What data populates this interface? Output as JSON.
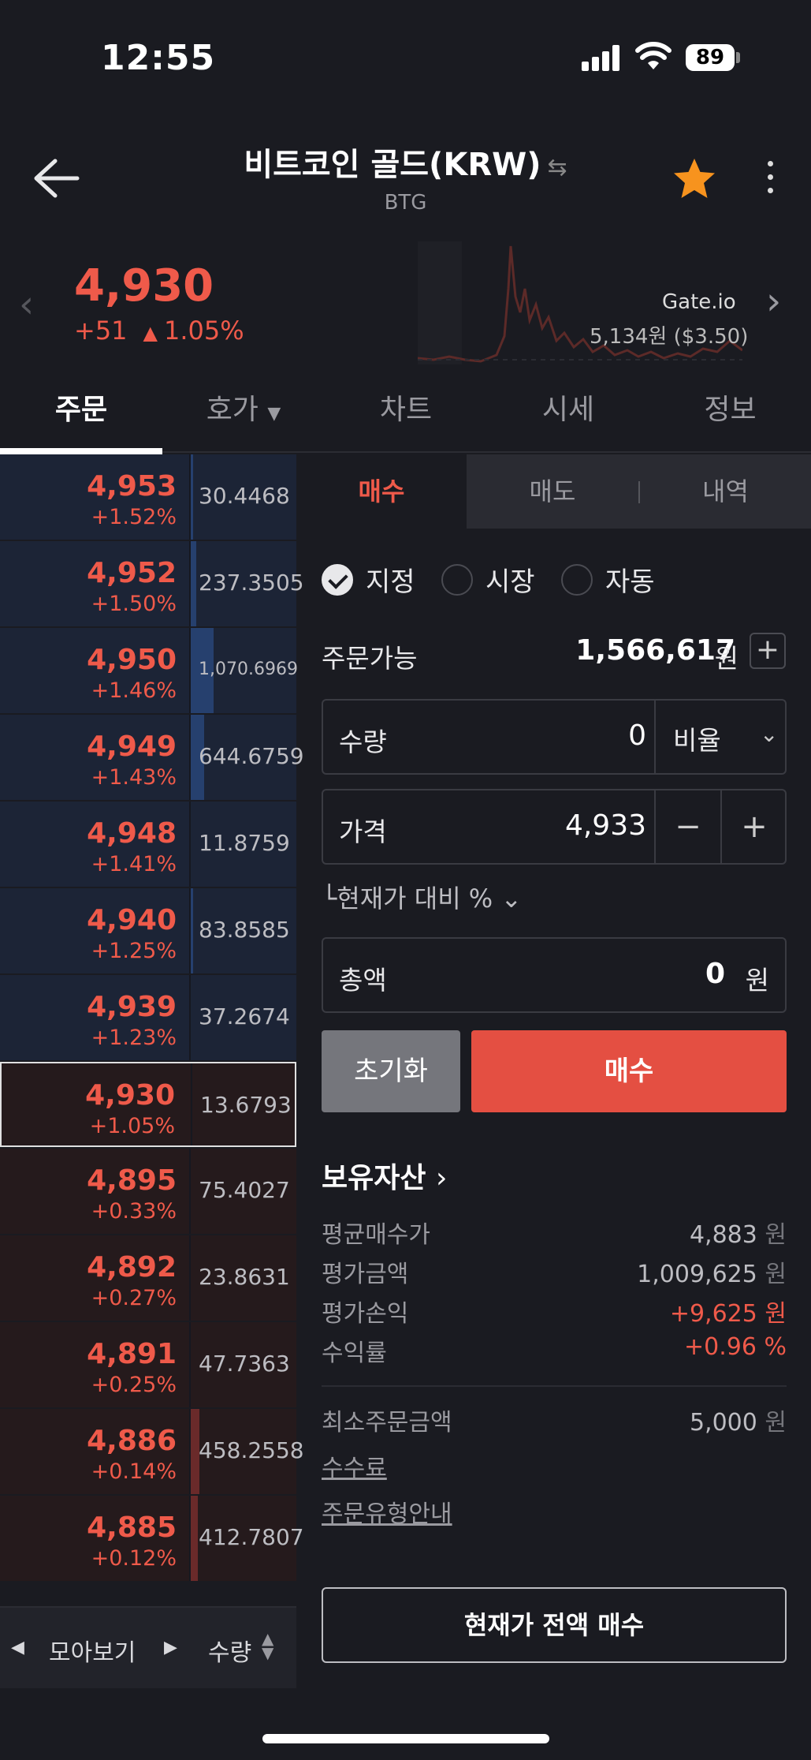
{
  "status": {
    "time": "12:55",
    "battery": "89"
  },
  "header": {
    "title": "비트코인 골드(KRW)",
    "subtitle": "BTG"
  },
  "price": {
    "current": "4,930",
    "change": "+51",
    "change_pct": "1.05%",
    "exchange": "Gate.io",
    "ref_price": "5,134원 ($3.50)"
  },
  "tabs": [
    "주문",
    "호가",
    "차트",
    "시세",
    "정보"
  ],
  "orderbook": {
    "rows": [
      {
        "price": "4,953",
        "pct": "+1.52%",
        "qty": "30.4468",
        "side": "ask",
        "bar": 0.02
      },
      {
        "price": "4,952",
        "pct": "+1.50%",
        "qty": "237.3505",
        "side": "ask",
        "bar": 0.05
      },
      {
        "price": "4,950",
        "pct": "+1.46%",
        "qty": "1,070.6969",
        "side": "ask",
        "bar": 0.22
      },
      {
        "price": "4,949",
        "pct": "+1.43%",
        "qty": "644.6759",
        "side": "ask",
        "bar": 0.13
      },
      {
        "price": "4,948",
        "pct": "+1.41%",
        "qty": "11.8759",
        "side": "ask",
        "bar": 0.0
      },
      {
        "price": "4,940",
        "pct": "+1.25%",
        "qty": "83.8585",
        "side": "ask",
        "bar": 0.02
      },
      {
        "price": "4,939",
        "pct": "+1.23%",
        "qty": "37.2674",
        "side": "ask",
        "bar": 0.0
      },
      {
        "price": "4,930",
        "pct": "+1.05%",
        "qty": "13.6793",
        "side": "current",
        "bar": 0.0
      },
      {
        "price": "4,895",
        "pct": "+0.33%",
        "qty": "75.4027",
        "side": "bid",
        "bar": 0.0
      },
      {
        "price": "4,892",
        "pct": "+0.27%",
        "qty": "23.8631",
        "side": "bid",
        "bar": 0.0
      },
      {
        "price": "4,891",
        "pct": "+0.25%",
        "qty": "47.7363",
        "side": "bid",
        "bar": 0.0
      },
      {
        "price": "4,886",
        "pct": "+0.14%",
        "qty": "458.2558",
        "side": "bid",
        "bar": 0.08
      },
      {
        "price": "4,885",
        "pct": "+0.12%",
        "qty": "412.7807",
        "side": "bid",
        "bar": 0.07
      }
    ],
    "footer": {
      "group_label": "모아보기",
      "sort_label": "수량"
    }
  },
  "order": {
    "tabs": [
      "매수",
      "매도",
      "내역"
    ],
    "types": [
      "지정",
      "시장",
      "자동"
    ],
    "available_label": "주문가능",
    "available_value": "1,566,617",
    "currency_unit": "원",
    "qty_label": "수량",
    "qty_value": "0",
    "ratio_label": "비율",
    "price_label": "가격",
    "price_value": "4,933",
    "compare_label": "현재가 대비 %",
    "total_label": "총액",
    "total_value": "0",
    "reset_label": "초기화",
    "buy_label": "매수"
  },
  "holdings": {
    "title": "보유자산",
    "rows": [
      {
        "label": "평균매수가",
        "value": "4,883",
        "unit": "원"
      },
      {
        "label": "평가금액",
        "value": "1,009,625",
        "unit": "원"
      },
      {
        "label": "평가손익",
        "value": "+9,625",
        "unit": "원"
      },
      {
        "label": "수익률",
        "value": "+0.96",
        "unit": "%"
      }
    ],
    "min_order_label": "최소주문금액",
    "min_order_value": "5,000",
    "fee_link": "수수료",
    "order_type_link": "주문유형안내",
    "full_buy_label": "현재가 전액 매수"
  }
}
